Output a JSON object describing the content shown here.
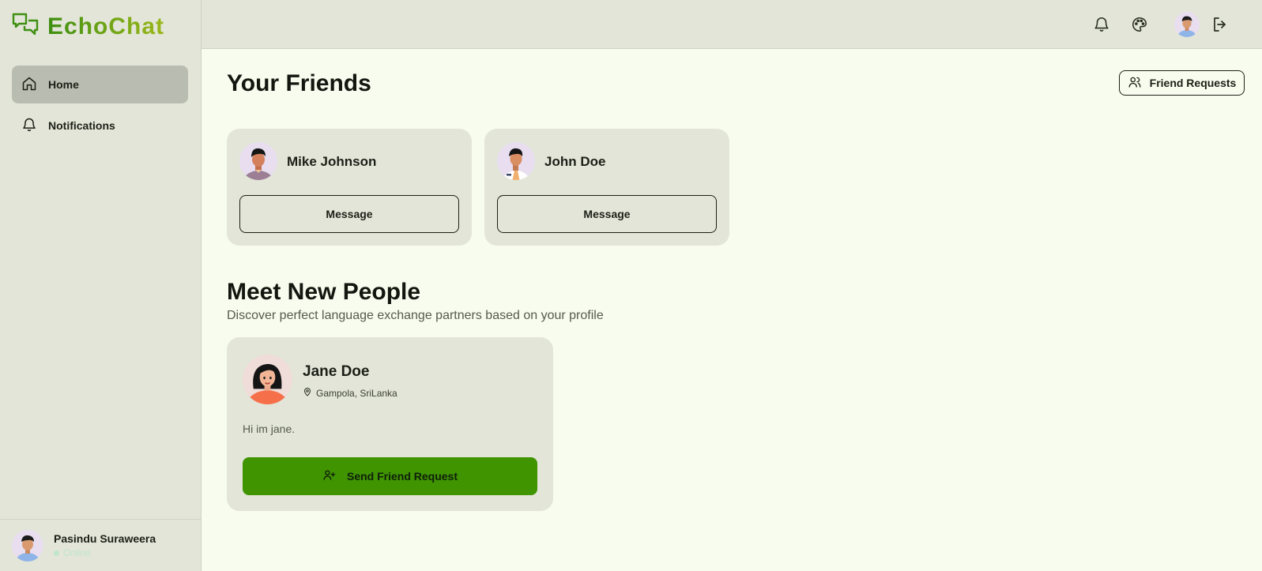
{
  "app": {
    "name": "EchoChat",
    "brand_color": "#3f8f12",
    "accent_color": "#3f9400"
  },
  "sidebar": {
    "items": [
      {
        "label": "Home",
        "icon": "home-icon",
        "active": true
      },
      {
        "label": "Notifications",
        "icon": "bell-icon",
        "active": false
      }
    ],
    "user": {
      "name": "Pasindu Suraweera",
      "status": "Online"
    }
  },
  "topbar": {
    "icons": [
      "bell-icon",
      "palette-icon",
      "avatar",
      "logout-icon"
    ]
  },
  "friends": {
    "title": "Your Friends",
    "requests_label": "Friend Requests",
    "list": [
      {
        "name": "Mike Johnson",
        "action": "Message"
      },
      {
        "name": "John Doe",
        "action": "Message"
      }
    ]
  },
  "discover": {
    "title": "Meet New People",
    "subtitle": "Discover perfect language exchange partners based on your profile",
    "people": [
      {
        "name": "Jane Doe",
        "location": "Gampola, SriLanka",
        "bio": "Hi im jane.",
        "action": "Send Friend Request"
      }
    ]
  }
}
